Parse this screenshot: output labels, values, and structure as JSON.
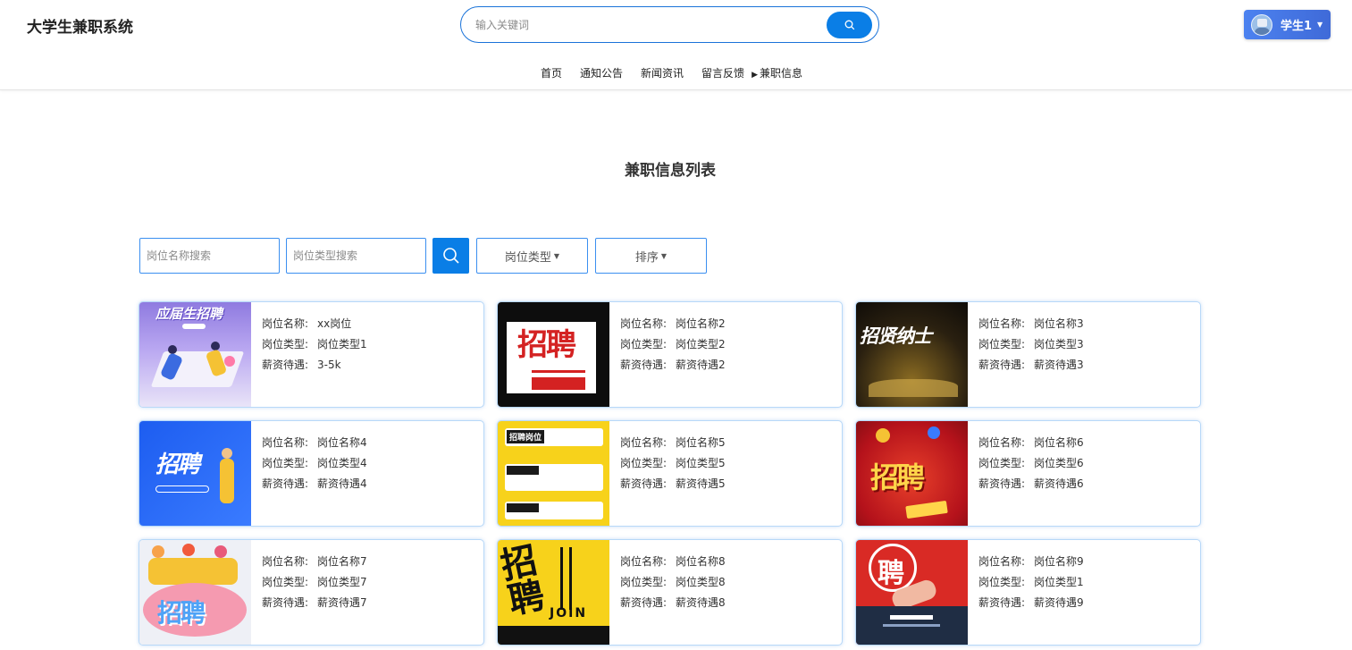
{
  "header": {
    "logo": "大学生兼职系统",
    "search_placeholder": "输入关键词",
    "user_name": "学生1"
  },
  "nav": {
    "items": [
      "首页",
      "通知公告",
      "新闻资讯",
      "留言反馈",
      "兼职信息"
    ],
    "active_index": 4
  },
  "main": {
    "title": "兼职信息列表",
    "filters": {
      "name_placeholder": "岗位名称搜索",
      "type_placeholder": "岗位类型搜索",
      "type_dropdown": "岗位类型",
      "sort_dropdown": "排序"
    },
    "labels": {
      "name": "岗位名称:",
      "type": "岗位类型:",
      "salary": "薪资待遇:"
    },
    "cards": [
      {
        "name": "xx岗位",
        "type": "岗位类型1",
        "salary": "3-5k",
        "image_text": "应届生招聘"
      },
      {
        "name": "岗位名称2",
        "type": "岗位类型2",
        "salary": "薪资待遇2",
        "image_text": "招聘"
      },
      {
        "name": "岗位名称3",
        "type": "岗位类型3",
        "salary": "薪资待遇3",
        "image_text": "招贤纳士"
      },
      {
        "name": "岗位名称4",
        "type": "岗位类型4",
        "salary": "薪资待遇4",
        "image_text": "招聘"
      },
      {
        "name": "岗位名称5",
        "type": "岗位类型5",
        "salary": "薪资待遇5",
        "image_text": "招聘岗位"
      },
      {
        "name": "岗位名称6",
        "type": "岗位类型6",
        "salary": "薪资待遇6",
        "image_text": "招聘"
      },
      {
        "name": "岗位名称7",
        "type": "岗位类型7",
        "salary": "薪资待遇7",
        "image_text": "招聘"
      },
      {
        "name": "岗位名称8",
        "type": "岗位类型8",
        "salary": "薪资待遇8",
        "image_text": "招聘"
      },
      {
        "name": "岗位名称9",
        "type": "岗位类型1",
        "salary": "薪资待遇9",
        "image_text": "聘"
      }
    ]
  },
  "colors": {
    "accent": "#0a7ee6",
    "active_nav": "#1a73d9",
    "card_border": "#b8d8f8"
  }
}
